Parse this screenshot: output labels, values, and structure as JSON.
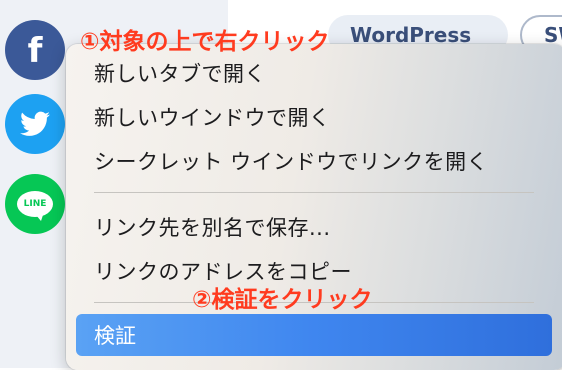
{
  "page": {
    "tags": [
      "WordPress",
      "SW"
    ]
  },
  "social": {
    "facebook_glyph": "f",
    "line_label": "LINE"
  },
  "annotations": {
    "step1": "①対象の上で右クリック",
    "step2": "②検証をクリック",
    "color": "#ff3b1f"
  },
  "context_menu": {
    "items": [
      {
        "label": "新しいタブで開く"
      },
      {
        "label": "新しいウインドウで開く"
      },
      {
        "label": "シークレット ウインドウでリンクを開く"
      },
      {
        "label": "リンク先を別名で保存..."
      },
      {
        "label": "リンクのアドレスをコピー"
      },
      {
        "label": "検証",
        "selected": true
      }
    ],
    "highlight_color": "#3f86ef"
  }
}
